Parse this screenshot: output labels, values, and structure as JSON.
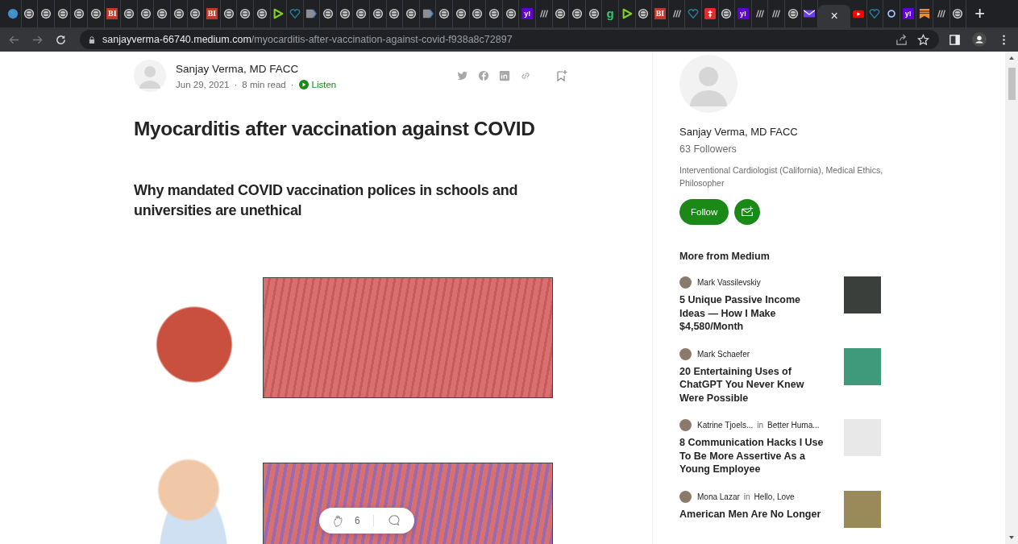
{
  "browser": {
    "tabs": [
      {
        "kind": "earth",
        "selected": false
      },
      {
        "kind": "globe",
        "selected": false
      },
      {
        "kind": "globe",
        "selected": false
      },
      {
        "kind": "globe",
        "selected": false
      },
      {
        "kind": "globe",
        "selected": false
      },
      {
        "kind": "globe",
        "selected": false
      },
      {
        "kind": "bi",
        "label": "BI",
        "selected": false
      },
      {
        "kind": "globe",
        "selected": false
      },
      {
        "kind": "globe",
        "selected": false
      },
      {
        "kind": "globe",
        "selected": false
      },
      {
        "kind": "globe",
        "selected": false
      },
      {
        "kind": "globe",
        "selected": false
      },
      {
        "kind": "bi",
        "label": "BI",
        "selected": false
      },
      {
        "kind": "globe",
        "selected": false
      },
      {
        "kind": "globe",
        "selected": false
      },
      {
        "kind": "globe",
        "selected": false
      },
      {
        "kind": "play",
        "selected": false
      },
      {
        "kind": "heart",
        "selected": false
      },
      {
        "kind": "arrow",
        "selected": false
      },
      {
        "kind": "globe",
        "selected": false
      },
      {
        "kind": "globe",
        "selected": false
      },
      {
        "kind": "globe",
        "selected": false
      },
      {
        "kind": "globe",
        "selected": false
      },
      {
        "kind": "globe",
        "selected": false
      },
      {
        "kind": "globe",
        "selected": false
      },
      {
        "kind": "arrow",
        "selected": false
      },
      {
        "kind": "globe",
        "selected": false
      },
      {
        "kind": "globe",
        "selected": false
      },
      {
        "kind": "globe",
        "selected": false
      },
      {
        "kind": "globe",
        "selected": false
      },
      {
        "kind": "globe",
        "selected": false
      },
      {
        "kind": "yahoo",
        "label": "y!",
        "selected": false
      },
      {
        "kind": "stripes",
        "selected": false
      },
      {
        "kind": "globe",
        "selected": false
      },
      {
        "kind": "globe",
        "selected": false
      },
      {
        "kind": "globe",
        "selected": false
      },
      {
        "kind": "g",
        "label": "g",
        "selected": false
      },
      {
        "kind": "play",
        "selected": false
      },
      {
        "kind": "globe",
        "selected": false
      },
      {
        "kind": "bi",
        "label": "BI",
        "selected": false
      },
      {
        "kind": "stripes",
        "selected": false
      },
      {
        "kind": "heart",
        "selected": false
      },
      {
        "kind": "pocket",
        "selected": false
      },
      {
        "kind": "globe",
        "selected": false
      },
      {
        "kind": "yahoo",
        "label": "y!",
        "selected": false
      },
      {
        "kind": "stripes",
        "selected": false
      },
      {
        "kind": "stripes",
        "selected": false
      },
      {
        "kind": "globe",
        "selected": false
      },
      {
        "kind": "mail",
        "selected": false
      },
      {
        "kind": "medium",
        "selected": true,
        "close": "×"
      },
      {
        "kind": "youtube",
        "selected": false
      },
      {
        "kind": "heart",
        "selected": false
      },
      {
        "kind": "ring",
        "selected": false
      },
      {
        "kind": "yahoo",
        "label": "y!",
        "selected": false
      },
      {
        "kind": "bookmark",
        "selected": false
      },
      {
        "kind": "stripes",
        "selected": false
      },
      {
        "kind": "globe",
        "selected": false
      }
    ],
    "new_tab": "+",
    "url": {
      "host": "sanjayverma-66740.medium.com",
      "path": "/myocarditis-after-vaccination-against-covid-f938a8c72897"
    }
  },
  "article": {
    "author": "Sanjay Verma, MD FACC",
    "date": "Jun 29, 2021",
    "separator_1": "·",
    "read_time": "8 min read",
    "separator_2": "·",
    "listen": "Listen",
    "title": "Myocarditis after vaccination against COVID",
    "subtitle": "Why mandated COVID vaccination polices in schools and universities are unethical",
    "claps": "6"
  },
  "sidebar": {
    "author": "Sanjay Verma, MD FACC",
    "followers": "63 Followers",
    "bio": "Interventional Cardiologist (California), Medical Ethics, Philosopher",
    "follow": "Follow",
    "more_heading": "More from Medium",
    "stories": [
      {
        "author": "Mark Vassilevskiy",
        "title": "5 Unique Passive Income Ideas — How I Make $4,580/Month",
        "color": "#3a3f3c"
      },
      {
        "author": "Mark Schaefer",
        "title": "20 Entertaining Uses of ChatGPT You Never Knew Were Possible",
        "color": "#3f9a7c"
      },
      {
        "author": "Katrine Tjoels...",
        "in": "in",
        "publication": "Better Huma...",
        "title": "8 Communication Hacks I Use To Be More Assertive As a Young Employee",
        "color": "#e8e8e8"
      },
      {
        "author": "Mona Lazar",
        "in": "in",
        "publication": "Hello, Love",
        "title": "American Men Are No Longer",
        "color": "#9a8a5a"
      }
    ]
  }
}
